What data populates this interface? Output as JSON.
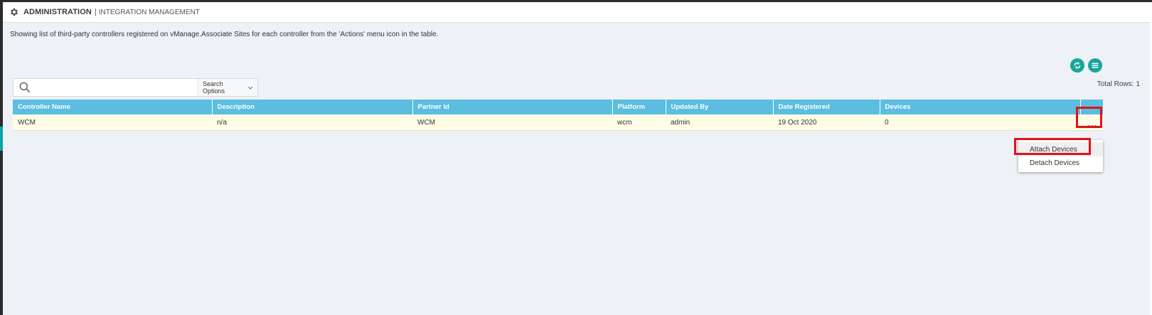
{
  "header": {
    "section": "ADMINISTRATION",
    "separator": "|",
    "subsection": "INTEGRATION MANAGEMENT",
    "icon": "gear-icon"
  },
  "description": "Showing list of third-party controllers registered on vManage.Associate Sites for each controller from the 'Actions' menu icon in the table.",
  "toolbar": {
    "refresh_icon": "refresh-icon",
    "menu_icon": "list-menu-icon",
    "accent_color": "#18a69b"
  },
  "search": {
    "placeholder": "",
    "value": "",
    "options_label": "Search Options"
  },
  "total_rows": {
    "label": "Total Rows:",
    "value": "1"
  },
  "table": {
    "header_color": "#5bbde0",
    "columns": [
      "Controller Name",
      "Description",
      "Partner Id",
      "Platform",
      "Updated By",
      "Date Registered",
      "Devices"
    ],
    "rows": [
      {
        "controller_name": "WCM",
        "description": "n/a",
        "partner_id": "WCM",
        "platform": "wcm",
        "updated_by": "admin",
        "date_registered": "19 Oct 2020",
        "devices": "0",
        "actions": "..."
      }
    ]
  },
  "actions_menu": {
    "items": [
      "Attach Devices",
      "Detach Devices"
    ],
    "highlighted": "Attach Devices"
  },
  "annotation_color": "#e4101b"
}
